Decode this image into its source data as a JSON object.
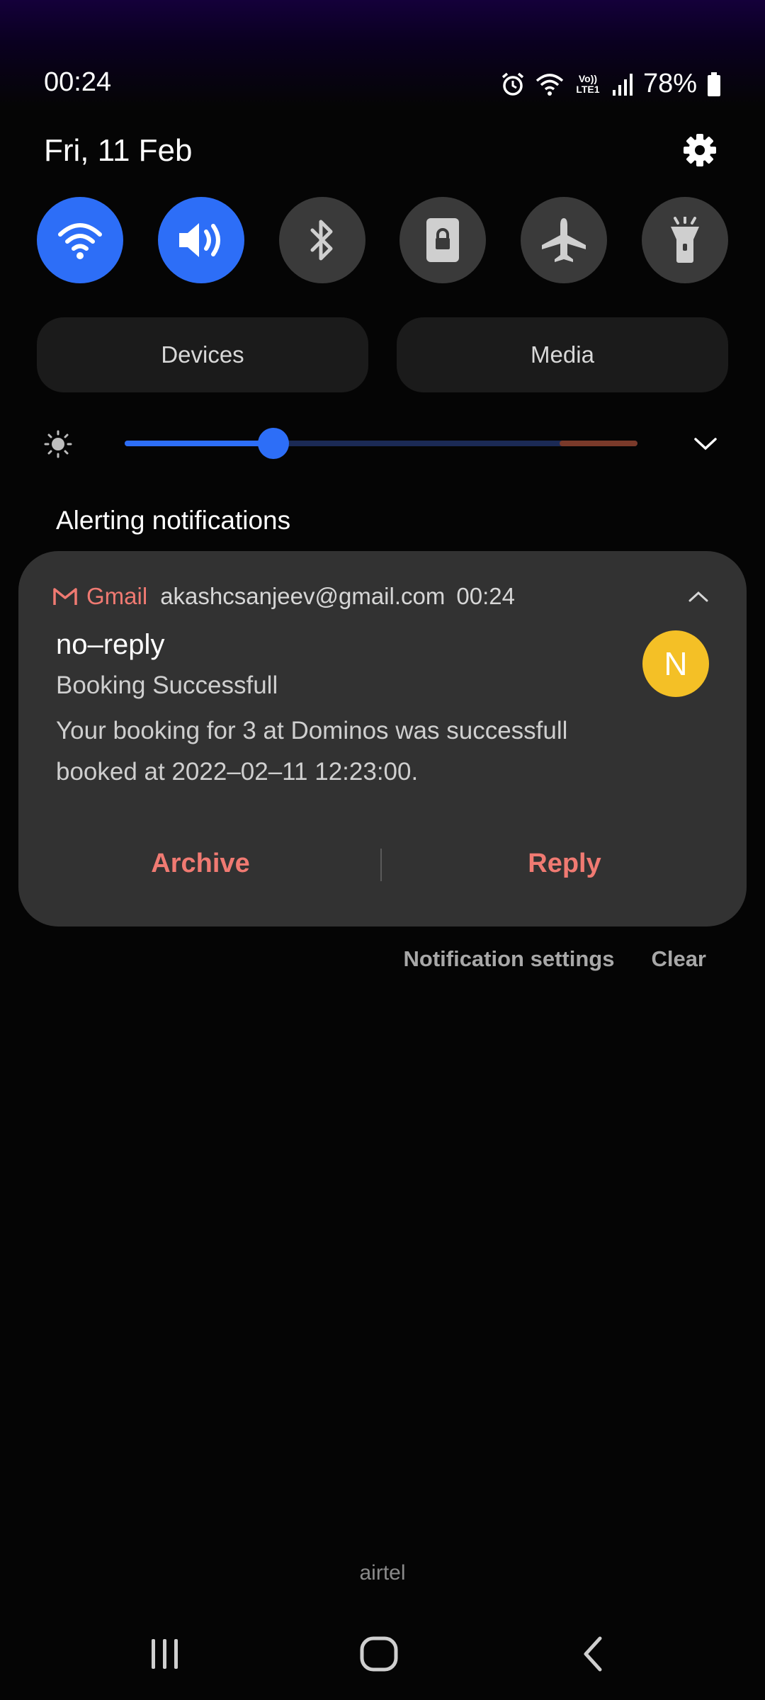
{
  "status_bar": {
    "time": "00:24",
    "network_label": "Vo)) LTE1",
    "battery": "78%"
  },
  "date": "Fri, 11 Feb",
  "quick_toggles": [
    {
      "name": "wifi",
      "state": "on"
    },
    {
      "name": "sound",
      "state": "on"
    },
    {
      "name": "bluetooth",
      "state": "off"
    },
    {
      "name": "rotation-lock",
      "state": "off"
    },
    {
      "name": "airplane-mode",
      "state": "off"
    },
    {
      "name": "flashlight",
      "state": "off"
    }
  ],
  "panels": {
    "devices_label": "Devices",
    "media_label": "Media"
  },
  "brightness": {
    "level": 0.29
  },
  "section_title": "Alerting notifications",
  "notification": {
    "app": "Gmail",
    "account": "akashcsanjeev@gmail.com",
    "time": "00:24",
    "sender": "no–reply",
    "subject": "Booking Successfull",
    "body": "Your booking for 3 at Dominos was successfull booked at 2022–02–11 12:23:00.",
    "avatar_letter": "N",
    "avatar_color": "#f4c026",
    "accent_color": "#f07a72",
    "actions": {
      "archive": "Archive",
      "reply": "Reply"
    }
  },
  "footer": {
    "settings_label": "Notification settings",
    "clear_label": "Clear"
  },
  "carrier": "airtel",
  "colors": {
    "toggle_on": "#2d6ef7",
    "toggle_off": "#3a3a3a",
    "card_bg": "#323232"
  }
}
